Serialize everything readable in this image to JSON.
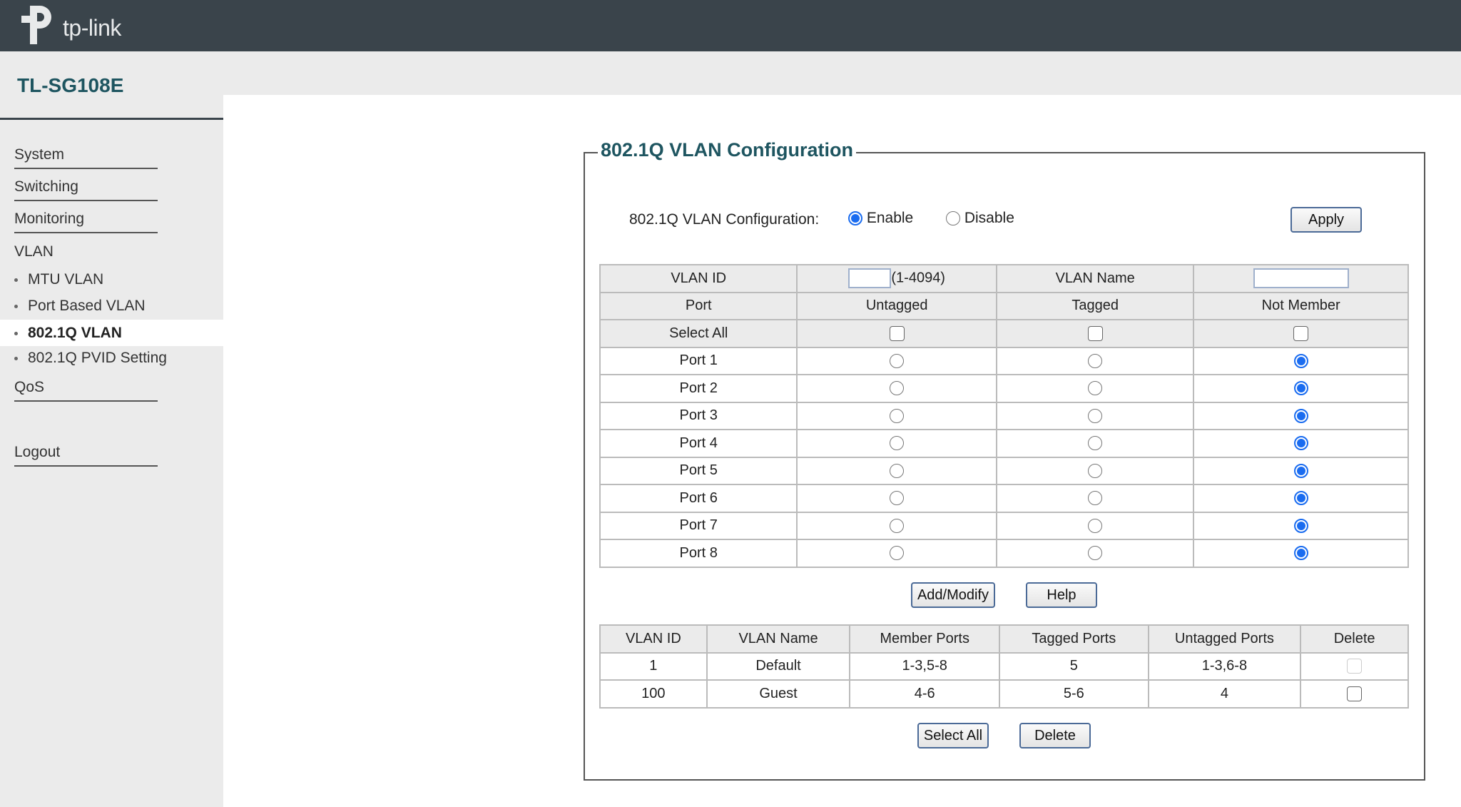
{
  "header": {
    "logo_text": "tp-link"
  },
  "sidebar": {
    "model": "TL-SG108E",
    "items": [
      {
        "label": "System"
      },
      {
        "label": "Switching"
      },
      {
        "label": "Monitoring"
      },
      {
        "label": "VLAN"
      },
      {
        "label": "QoS"
      },
      {
        "label": "Logout"
      }
    ],
    "vlan_sub": [
      {
        "label": "MTU VLAN"
      },
      {
        "label": "Port Based VLAN"
      },
      {
        "label": "802.1Q VLAN",
        "active": true
      },
      {
        "label": "802.1Q PVID Setting"
      }
    ]
  },
  "main": {
    "title": "802.1Q VLAN Configuration",
    "config": {
      "label": "802.1Q VLAN Configuration:",
      "enable": "Enable",
      "disable": "Disable",
      "selected": "Enable",
      "apply": "Apply"
    },
    "form": {
      "vlan_id_label": "VLAN ID",
      "vlan_id_value": "",
      "vlan_id_range": "(1-4094)",
      "vlan_name_label": "VLAN Name",
      "vlan_name_value": "",
      "headers": [
        "Port",
        "Untagged",
        "Tagged",
        "Not Member"
      ],
      "select_all": "Select All",
      "ports": [
        {
          "name": "Port 1",
          "mode": "Not Member"
        },
        {
          "name": "Port 2",
          "mode": "Not Member"
        },
        {
          "name": "Port 3",
          "mode": "Not Member"
        },
        {
          "name": "Port 4",
          "mode": "Not Member"
        },
        {
          "name": "Port 5",
          "mode": "Not Member"
        },
        {
          "name": "Port 6",
          "mode": "Not Member"
        },
        {
          "name": "Port 7",
          "mode": "Not Member"
        },
        {
          "name": "Port 8",
          "mode": "Not Member"
        }
      ]
    },
    "buttons": {
      "add_modify": "Add/Modify",
      "help": "Help",
      "select_all": "Select All",
      "delete": "Delete"
    },
    "vlan_table": {
      "headers": [
        "VLAN ID",
        "VLAN Name",
        "Member Ports",
        "Tagged Ports",
        "Untagged Ports",
        "Delete"
      ],
      "rows": [
        {
          "id": "1",
          "name": "Default",
          "member": "1-3,5-8",
          "tagged": "5",
          "untagged": "1-3,6-8",
          "delete_disabled": true
        },
        {
          "id": "100",
          "name": "Guest",
          "member": "4-6",
          "tagged": "5-6",
          "untagged": "4",
          "delete_disabled": false
        }
      ]
    }
  },
  "colors": {
    "header": "#3a444b",
    "accent": "#1e5560",
    "radio": "#1a6cf0"
  }
}
